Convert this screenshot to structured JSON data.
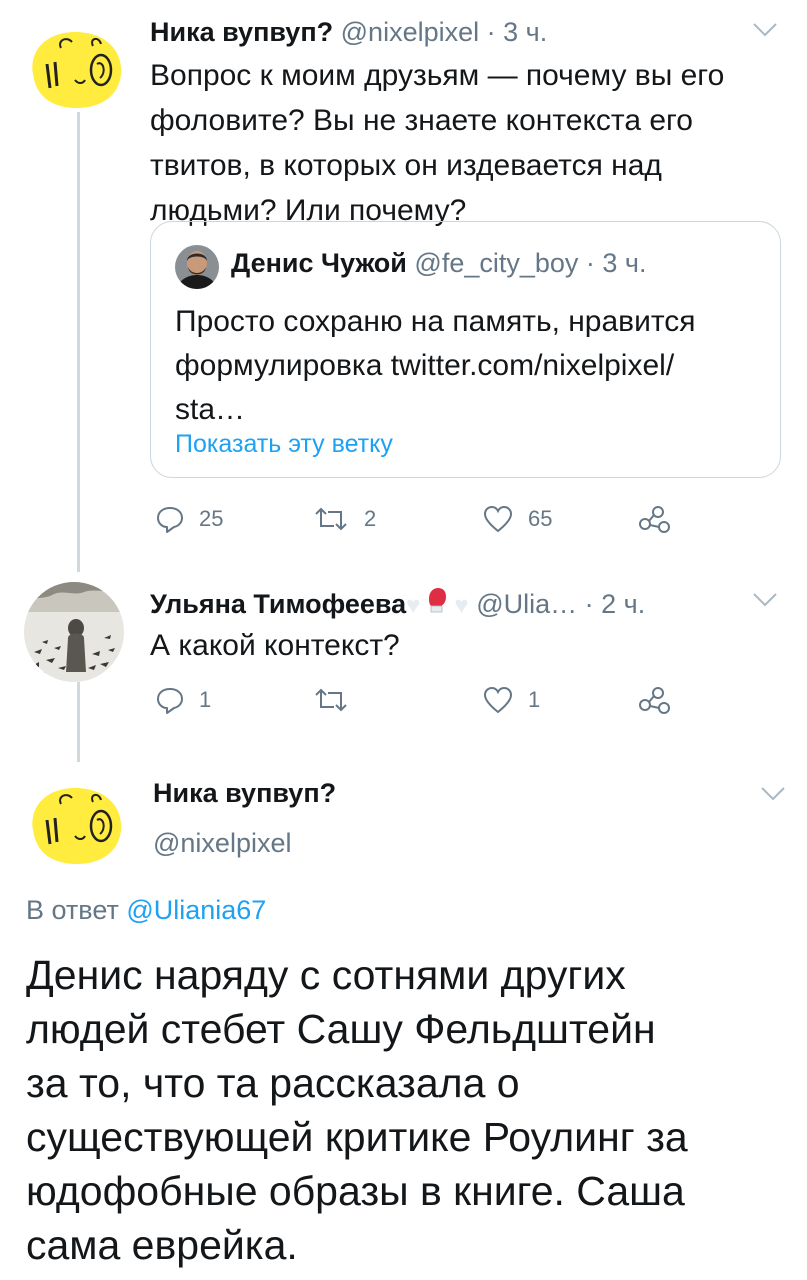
{
  "tweet1": {
    "name": "Ника вупвуп?",
    "handle": "@nixelpixel",
    "time": "· 3 ч.",
    "text_lines": [
      "Вопрос к моим друзьям — почему вы его",
      "фоловите? Вы не знаете контекста его",
      "твитов, в которых он издевается над",
      "людьми? Или почему?"
    ],
    "quote": {
      "name": "Денис Чужой",
      "handle": "@fe_city_boy",
      "time": "· 3 ч.",
      "text_lines": [
        "Просто сохраню на память, нравится",
        "формулировка twitter.com/nixelpixel/",
        "sta…"
      ],
      "show_thread": "Показать эту ветку"
    },
    "actions": {
      "replies": "25",
      "retweets": "2",
      "likes": "65"
    }
  },
  "tweet2": {
    "name": "Ульяна Тимофеева",
    "handle": "@Ulia…",
    "time": "· 2 ч.",
    "text": "А какой контекст?",
    "actions": {
      "replies": "1",
      "retweets": "",
      "likes": "1"
    }
  },
  "main_tweet": {
    "name": "Ника вупвуп?",
    "handle": "@nixelpixel",
    "reply_prefix": "В ответ",
    "reply_to": "@Uliania67",
    "text_lines": [
      "Денис наряду с сотнями других",
      "людей стебет Сашу Фельдштейн",
      "за то, что та рассказала о",
      "существующей критике Роулинг за",
      "юдофобные образы в книге. Саша",
      "сама еврейка."
    ]
  },
  "icons": {
    "reply": "reply-icon",
    "retweet": "retweet-icon",
    "like": "heart-icon",
    "share": "share-icon",
    "menu": "chevron-down-icon"
  },
  "colors": {
    "text": "#14171a",
    "secondary": "#657786",
    "link": "#1da1f2",
    "border": "#ccd6dd",
    "thread_line": "#cfd9de",
    "avatar_yellow": "#ffec3f"
  }
}
